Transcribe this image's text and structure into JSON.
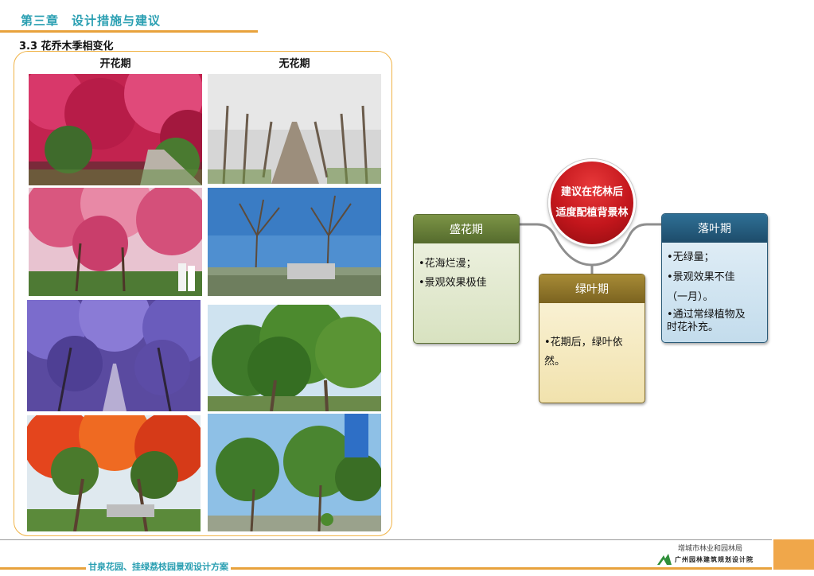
{
  "header": {
    "chapter": "第三章　设计措施与建议",
    "section": "3.3 花乔木季相变化"
  },
  "photos": {
    "col_bloom": "开花期",
    "col_nobloom": "无花期"
  },
  "diagram": {
    "center_line1": "建议在花林后",
    "center_line2": "适度配植背景林",
    "peak": {
      "title": "盛花期",
      "items": [
        "•花海烂漫；",
        "•景观效果极佳"
      ]
    },
    "green": {
      "title": "绿叶期",
      "items": [
        "•花期后，绿叶依然。"
      ]
    },
    "fall": {
      "title": "落叶期",
      "items": [
        "•无绿量；",
        "•景观效果不佳",
        "（一月）。",
        "•通过常绿植物及",
        "时花补充。"
      ]
    }
  },
  "footer": {
    "project_title": "甘泉花园、挂绿荔枝园景观设计方案",
    "agency_line1": "增城市林业和园林局",
    "agency_line2": "广州园林建筑规划设计院"
  }
}
